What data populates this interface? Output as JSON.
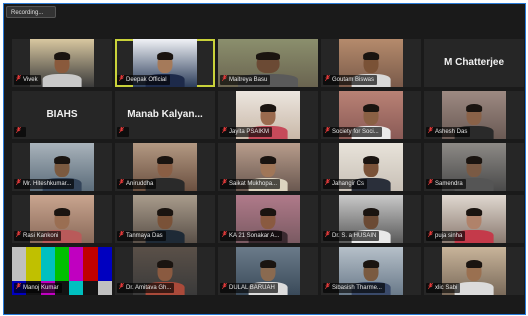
{
  "recording_label": "Recording...",
  "tiles": [
    {
      "name": "Vivek",
      "kind": "video",
      "bg": "#3b3b3b",
      "skin": "#8a5a3c",
      "shirt": "#c9c9c9",
      "scene": "#d8c7a0"
    },
    {
      "name": "Deepak Official",
      "kind": "video",
      "bg": "#2c3d5a",
      "skin": "#a57a5a",
      "shirt": "#1d2a4a",
      "scene": "#f0f2f6",
      "active": true
    },
    {
      "name": "Maitreya Basu",
      "kind": "video",
      "bg": "#6a6450",
      "skin": "#6b4a34",
      "shirt": "#5a5a5a",
      "scene": "#8b8f6d",
      "full": true
    },
    {
      "name": "Goutam Biswas",
      "kind": "video",
      "bg": "#7a5a4a",
      "skin": "#7a5236",
      "shirt": "#d8d8d8",
      "scene": "#b58b6c"
    },
    {
      "name": "M Chatterjee",
      "kind": "name"
    },
    {
      "name": "BIAHS",
      "kind": "name",
      "mic": true
    },
    {
      "name": "Manab Kalyan...",
      "kind": "name",
      "mic": true
    },
    {
      "name": "Jayita PSAIKM",
      "kind": "video",
      "bg": "#c9b8a8",
      "skin": "#9a6a4e",
      "shirt": "#c64a5a",
      "scene": "#ece6df"
    },
    {
      "name": "Society for Soci...",
      "kind": "video",
      "bg": "#8a5a56",
      "skin": "#8a6044",
      "shirt": "#eaeaea",
      "scene": "#b98275"
    },
    {
      "name": "Ashesh Das",
      "kind": "video",
      "bg": "#6a5a54",
      "skin": "#8a6248",
      "shirt": "#2a2a2a",
      "scene": "#9d8a82"
    },
    {
      "name": "Mr. Hiteshkumar...",
      "kind": "video",
      "bg": "#5b6c7a",
      "skin": "#7b5a40",
      "shirt": "#33445a",
      "scene": "#a9b3bb"
    },
    {
      "name": "Aniruddha",
      "kind": "video",
      "bg": "#6b5040",
      "skin": "#8a5e44",
      "shirt": "#2a2a2a",
      "scene": "#b39983"
    },
    {
      "name": "Saikat Mukhopa...",
      "kind": "video",
      "bg": "#6a5850",
      "skin": "#a07658",
      "shirt": "#ddd4c0",
      "scene": "#b89d8c"
    },
    {
      "name": "Jahangir Cs",
      "kind": "video",
      "bg": "#c8c0b6",
      "skin": "#7a5238",
      "shirt": "#2a2f3a",
      "scene": "#e8e3da"
    },
    {
      "name": "Samendra",
      "kind": "video",
      "bg": "#4a4a4a",
      "skin": "#7a5a44",
      "shirt": "#555",
      "scene": "#8d8a86"
    },
    {
      "name": "Rasi Kankoni",
      "kind": "video",
      "bg": "#8a6a5a",
      "skin": "#9a6e52",
      "shirt": "#b95a5a",
      "scene": "#c9a58f"
    },
    {
      "name": "Tanmaya Das",
      "kind": "video",
      "bg": "#5a5048",
      "skin": "#7a5238",
      "shirt": "#1e2a36",
      "scene": "#a99c8c"
    },
    {
      "name": "KA 21 Sonakar A...",
      "kind": "video",
      "bg": "#7a5a62",
      "skin": "#8a5a40",
      "shirt": "#3a2a30",
      "scene": "#b07a8a"
    },
    {
      "name": "Dr. S. a HUSAIN",
      "kind": "video",
      "bg": "#5a5a5a",
      "skin": "#6b4a34",
      "shirt": "#e8e8e8",
      "scene": "#c9c9c9"
    },
    {
      "name": "puja sinha",
      "kind": "video",
      "bg": "#8a7a70",
      "skin": "#b0826a",
      "shirt": "#c43a4a",
      "scene": "#e0d8d0"
    },
    {
      "name": "Manoj Kumar",
      "kind": "bars",
      "mic": true
    },
    {
      "name": "Dr. Amitava Gh...",
      "kind": "video",
      "bg": "#3a3a3a",
      "skin": "#8a5a40",
      "shirt": "#aa4a3a",
      "scene": "#5a5048"
    },
    {
      "name": "DULAL BARUAH",
      "kind": "video",
      "bg": "#3a4a5a",
      "skin": "#8a6a50",
      "shirt": "#dcdcdc",
      "scene": "#6b7b8a"
    },
    {
      "name": "Sibasish Tharme...",
      "kind": "video",
      "bg": "#6a7a8a",
      "skin": "#7a5a40",
      "shirt": "#3a4a6a",
      "scene": "#b6c0c9"
    },
    {
      "name": "xlic Sabi",
      "kind": "video",
      "bg": "#7a6a5a",
      "skin": "#9a7050",
      "shirt": "#dbdbdb",
      "scene": "#c8b49a"
    }
  ],
  "colors": {
    "background": "#1a1a1a",
    "tile": "#262626",
    "active_border": "#c9d23a",
    "muted_mic": "#e03a3a"
  },
  "test_bars": [
    "#c0c0c0",
    "#c0c000",
    "#00c0c0",
    "#00c000",
    "#c000c0",
    "#c00000",
    "#0000c0"
  ],
  "test_bars_bottom": [
    "#0000c0",
    "#131313",
    "#c000c0",
    "#131313",
    "#00c0c0",
    "#131313",
    "#c0c0c0"
  ]
}
